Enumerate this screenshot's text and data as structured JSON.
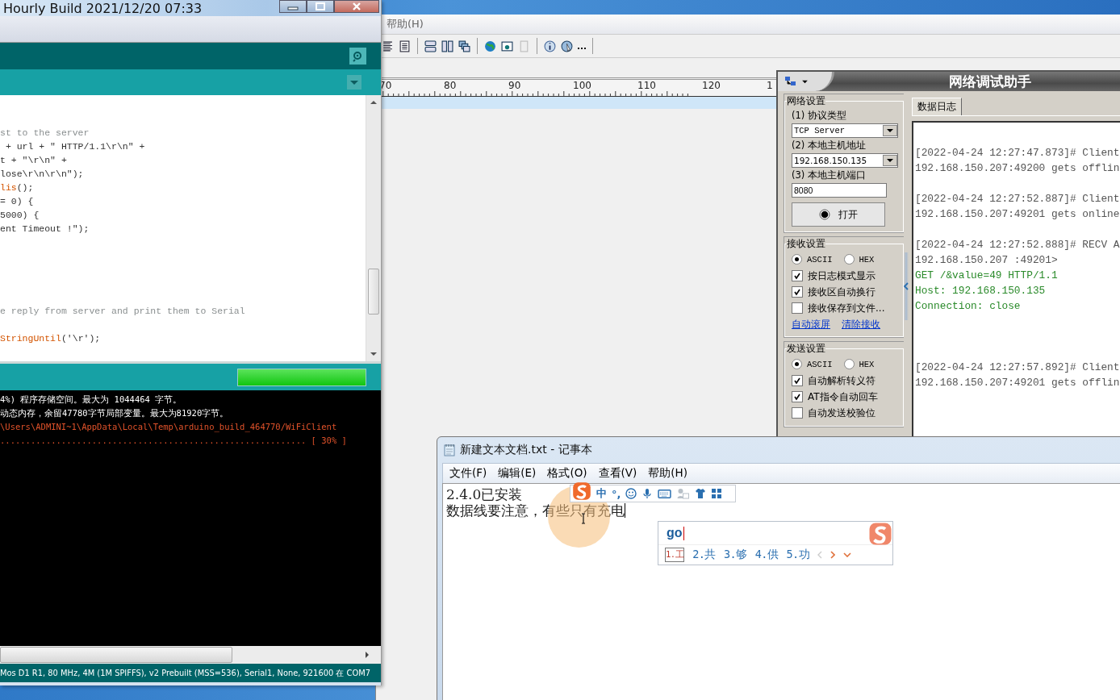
{
  "background_window": {
    "menu": [
      "帮助(H)"
    ],
    "ruler_labels": [
      "70",
      "80",
      "90",
      "100",
      "110",
      "120",
      "1"
    ]
  },
  "arduino": {
    "title": "Hourly Build 2021/12/20 07:33",
    "code_lines": [
      {
        "kind": "blank"
      },
      {
        "kind": "blank"
      },
      {
        "kind": "code",
        "spans": [
          {
            "text": "st to the server",
            "kind": "comment"
          }
        ]
      },
      {
        "kind": "code",
        "spans": [
          {
            "text": " + url + \" HTTP/1.1\\r\\n\" +",
            "kind": "plain"
          }
        ]
      },
      {
        "kind": "code",
        "spans": [
          {
            "text": "t + \"\\r\\n\" +",
            "kind": "plain"
          }
        ]
      },
      {
        "kind": "code",
        "spans": [
          {
            "text": "lose\\r\\n\\r\\n\");",
            "kind": "plain"
          }
        ]
      },
      {
        "kind": "code",
        "spans": [
          {
            "text": "lis",
            "kind": "function"
          },
          {
            "text": "();",
            "kind": "plain"
          }
        ]
      },
      {
        "kind": "code",
        "spans": [
          {
            "text": "= 0) {",
            "kind": "plain"
          }
        ]
      },
      {
        "kind": "code",
        "spans": [
          {
            "text": "5000) {",
            "kind": "plain"
          }
        ]
      },
      {
        "kind": "code",
        "spans": [
          {
            "text": "ent Timeout !\");",
            "kind": "plain"
          }
        ]
      },
      {
        "kind": "blank"
      },
      {
        "kind": "blank"
      },
      {
        "kind": "blank"
      },
      {
        "kind": "blank"
      },
      {
        "kind": "blank"
      },
      {
        "kind": "code",
        "spans": [
          {
            "text": "e reply from server and print them to Serial",
            "kind": "comment"
          }
        ]
      },
      {
        "kind": "blank"
      },
      {
        "kind": "code",
        "spans": [
          {
            "text": "StringUntil",
            "kind": "function"
          },
          {
            "text": "('\\r');",
            "kind": "plain"
          }
        ]
      }
    ],
    "progress": {
      "level": 1
    },
    "console_lines": [
      {
        "text": "4%) 程序存储空间。最大为 1044464 字节。",
        "kind": "info"
      },
      {
        "text": "动态内存，余留47780字节局部变量。最大为81920字节。",
        "kind": "info"
      },
      {
        "text": "\\Users\\ADMINI~1\\AppData\\Local\\Temp\\arduino_build_464770/WiFiClient",
        "kind": "error"
      },
      {
        "text": "............................................................ [ 30% ]",
        "kind": "error"
      }
    ],
    "status_bar": "Mos D1 R1, 80 MHz, 4M (1M SPIFFS), v2 Prebuilt (MSS=536), Serial1, None, 921600 在 COM7"
  },
  "net_tool": {
    "title": "网络调试助手",
    "network_settings": {
      "title": "网络设置",
      "protocol_label": "(1) 协议类型",
      "protocol": "TCP Server",
      "host_label": "(2) 本地主机地址",
      "host": "192.168.150.135",
      "port_label": "(3) 本地主机端口",
      "port": "8080",
      "open_button": "打开"
    },
    "receive_settings": {
      "title": "接收设置",
      "radios": [
        {
          "label": "ASCII",
          "selected": true
        },
        {
          "label": "HEX",
          "selected": false
        }
      ],
      "checkboxes": [
        {
          "label": "按日志模式显示",
          "checked": true
        },
        {
          "label": "接收区自动换行",
          "checked": true
        },
        {
          "label": "接收保存到文件...",
          "checked": false
        }
      ],
      "links": [
        "自动滚屏",
        "清除接收"
      ]
    },
    "send_settings": {
      "title": "发送设置",
      "radios": [
        {
          "label": "ASCII",
          "selected": true
        },
        {
          "label": "HEX",
          "selected": false
        }
      ],
      "checkboxes": [
        {
          "label": "自动解析转义符",
          "checked": true
        },
        {
          "label": "AT指令自动回车",
          "checked": true
        },
        {
          "label": "自动发送校验位",
          "checked": false
        }
      ]
    },
    "log_tab": "数据日志",
    "log_entries": [
      {
        "header": "[2022-04-24 12:27:47.873]# Client",
        "lines": [
          "192.168.150.207:49200 gets offlin"
        ]
      },
      {
        "header": "[2022-04-24 12:27:52.887]# Client",
        "lines": [
          "192.168.150.207:49201 gets online"
        ]
      },
      {
        "header": "[2022-04-24 12:27:52.888]# RECV A",
        "lines": [
          "192.168.150.207 :49201>"
        ],
        "payload": [
          "GET /&value=49 HTTP/1.1",
          "Host: 192.168.150.135",
          "Connection: close"
        ]
      },
      {
        "header": "[2022-04-24 12:27:57.892]# Client",
        "lines": [
          "192.168.150.207:49201 gets offlin"
        ]
      }
    ]
  },
  "notepad": {
    "title": "新建文本文档.txt - 记事本",
    "menu": [
      "文件(F)",
      "编辑(E)",
      "格式(O)",
      "查看(V)",
      "帮助(H)"
    ],
    "lines": [
      "2.4.0已安装",
      "数据线要注意，有些只有充电"
    ],
    "ime": {
      "mode": "中",
      "punct": "°,",
      "input": "go",
      "candidates": [
        {
          "label": "1.工",
          "selected": true
        },
        {
          "label": "2.共",
          "selected": false
        },
        {
          "label": "3.够",
          "selected": false
        },
        {
          "label": "4.供",
          "selected": false
        },
        {
          "label": "5.功",
          "selected": false
        }
      ]
    }
  }
}
